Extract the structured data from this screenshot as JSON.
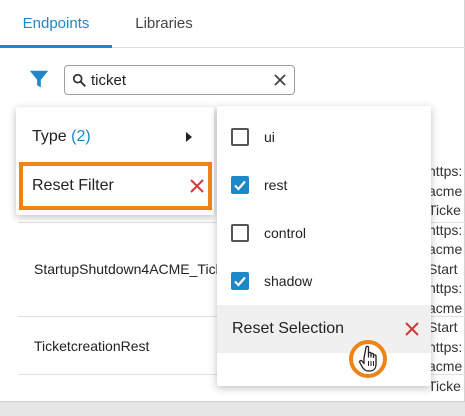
{
  "tabs": [
    {
      "label": "Endpoints",
      "active": true
    },
    {
      "label": "Libraries",
      "active": false
    }
  ],
  "filter": {
    "icon": "filter-icon",
    "search_value": "ticket",
    "search_icon": "search-icon",
    "clear_icon": "clear-icon"
  },
  "rows": [
    {
      "name": "StartupShutdown4ACME_Tick"
    },
    {
      "name": "TicketcreationRest"
    }
  ],
  "right_column_fragments": [
    "https:",
    "acme",
    "Ticke",
    "https:",
    "acme",
    "Start",
    "https:",
    "acme",
    "Start",
    "https:",
    "acme",
    "Ticke"
  ],
  "filter_menu": {
    "type_label": "Type",
    "type_count": "(2)",
    "reset_filter_label": "Reset Filter"
  },
  "type_submenu": {
    "options": [
      {
        "label": "ui",
        "checked": false
      },
      {
        "label": "rest",
        "checked": true
      },
      {
        "label": "control",
        "checked": false
      },
      {
        "label": "shadow",
        "checked": true
      }
    ],
    "reset_selection_label": "Reset Selection"
  },
  "colors": {
    "accent": "#1e88c7",
    "highlight": "#ee8416",
    "danger": "#d23b3b"
  }
}
